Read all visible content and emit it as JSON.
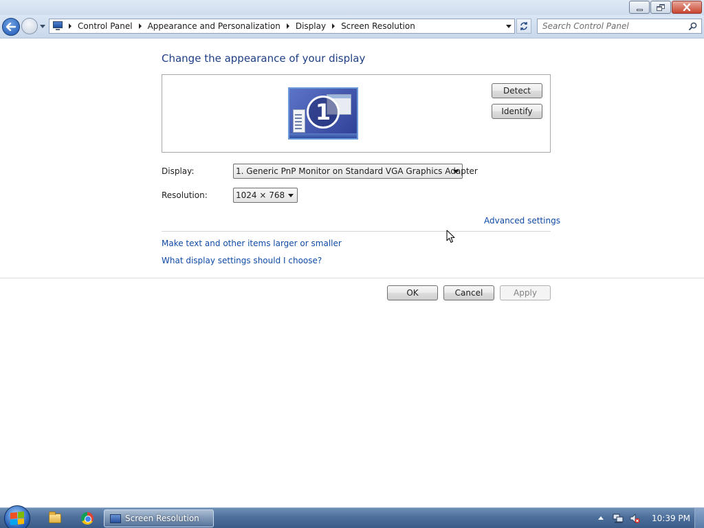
{
  "window": {
    "minimize_icon": "minimize-icon",
    "restore_icon": "restore-icon",
    "close_icon": "close-icon"
  },
  "navigation": {
    "breadcrumb": [
      "Control Panel",
      "Appearance and Personalization",
      "Display",
      "Screen Resolution"
    ],
    "search_placeholder": "Search Control Panel"
  },
  "main": {
    "heading": "Change the appearance of your display",
    "monitor_number": "1",
    "detect_label": "Detect",
    "identify_label": "Identify",
    "display_label": "Display:",
    "display_value": "1. Generic PnP Monitor on Standard VGA Graphics Adapter",
    "resolution_label": "Resolution:",
    "resolution_value": "1024 × 768",
    "advanced_link": "Advanced settings",
    "links": [
      "Make text and other items larger or smaller",
      "What display settings should I choose?"
    ],
    "ok_label": "OK",
    "cancel_label": "Cancel",
    "apply_label": "Apply"
  },
  "taskbar": {
    "active_task": "Screen Resolution",
    "clock": "10:39 PM"
  },
  "colors": {
    "link": "#0f4aa6",
    "heading": "#1e3e85",
    "taskbar": "#4d6f9b"
  }
}
